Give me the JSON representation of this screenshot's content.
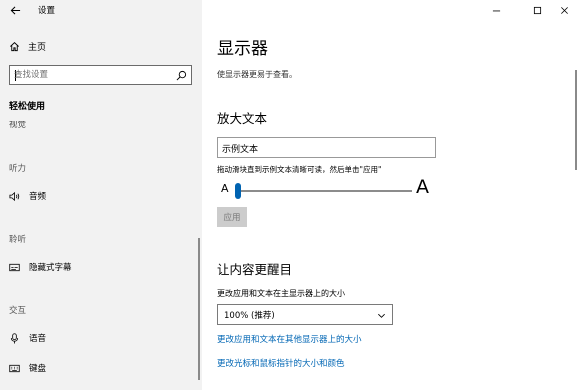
{
  "app": {
    "title": "设置"
  },
  "sidebar": {
    "home_label": "主页",
    "search_placeholder": "查找设置",
    "category_title": "轻松使用",
    "cut_item_label": "视觉",
    "sections": [
      {
        "header": "听力",
        "items": [
          {
            "label": "音频",
            "icon": "speaker-icon"
          }
        ]
      },
      {
        "header": "聆听",
        "items": [
          {
            "label": "隐藏式字幕",
            "icon": "captions-icon"
          }
        ]
      },
      {
        "header": "交互",
        "items": [
          {
            "label": "语音",
            "icon": "microphone-icon"
          },
          {
            "label": "键盘",
            "icon": "keyboard-icon"
          }
        ]
      }
    ]
  },
  "main": {
    "title": "显示器",
    "description": "使显示器更易于查看。",
    "enlarge_text": {
      "heading": "放大文本",
      "sample_text": "示例文本",
      "instruction": "拖动滑块直到示例文本清晰可读，然后单击\"应用\"",
      "small_a": "A",
      "big_a": "A",
      "slider_value_percent": 0,
      "apply_label": "应用"
    },
    "make_everything_bigger": {
      "heading": "让内容更醒目",
      "scale_label": "更改应用和文本在主显示器上的大小",
      "scale_value": "100% (推荐)",
      "link_other_display": "更改应用和文本在其他显示器上的大小",
      "link_cursor": "更改光标和鼠标指针的大小和颜色"
    }
  },
  "colors": {
    "accent": "#0063b1",
    "link": "#0066b4",
    "sidebar_bg": "#f2f2f2"
  }
}
